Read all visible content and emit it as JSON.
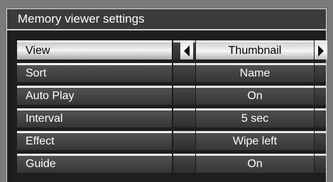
{
  "title": "Memory viewer settings",
  "rows": [
    {
      "label": "View",
      "value": "Thumbnail"
    },
    {
      "label": "Sort",
      "value": "Name"
    },
    {
      "label": "Auto Play",
      "value": "On"
    },
    {
      "label": "Interval",
      "value": "5 sec"
    },
    {
      "label": "Effect",
      "value": "Wipe left"
    },
    {
      "label": "Guide",
      "value": "On"
    }
  ],
  "icons": {
    "left": "left-arrow-icon",
    "right": "right-arrow-icon"
  }
}
